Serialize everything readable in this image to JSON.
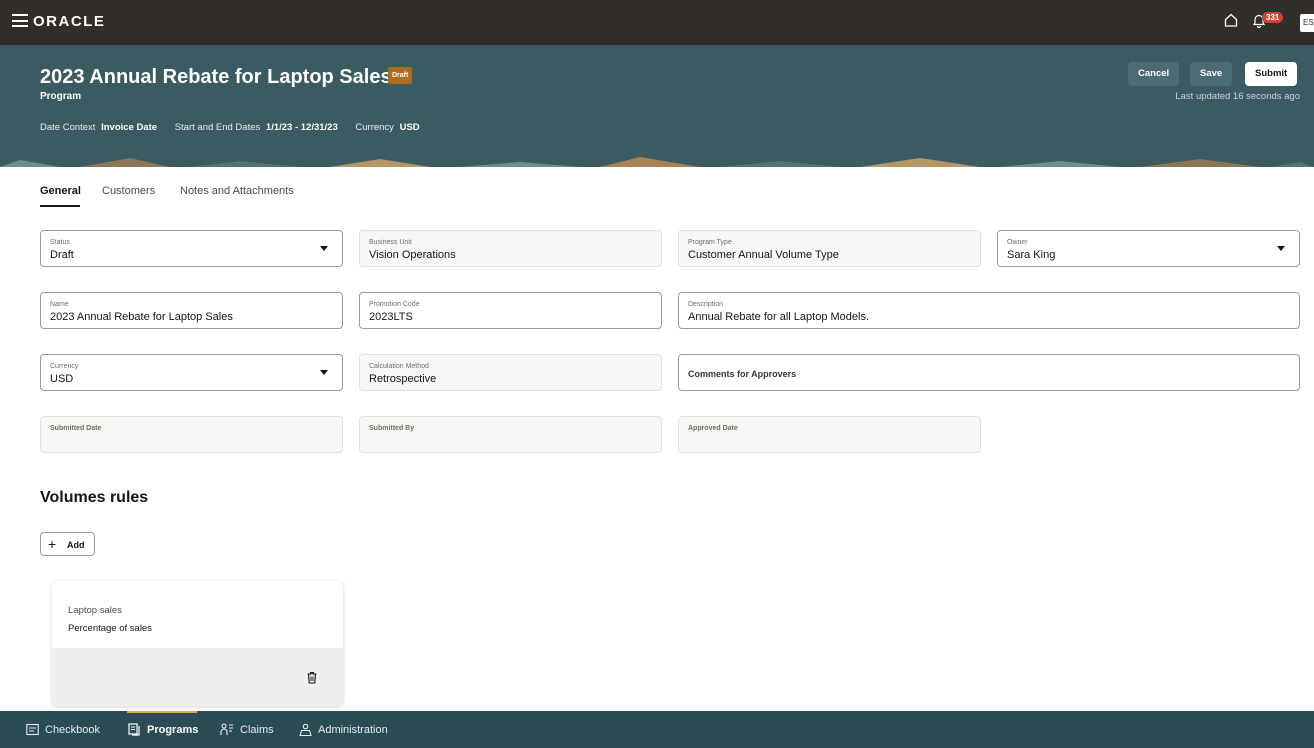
{
  "topbar": {
    "brand": "ORACLE",
    "notification_count": "331",
    "user_initials": "ES"
  },
  "header": {
    "title": "2023 Annual Rebate for Laptop Sales",
    "status_badge": "Draft",
    "subtitle": "Program",
    "date_context_label": "Date Context",
    "date_context_value": "Invoice Date",
    "dates_label": "Start and End Dates",
    "dates_value": "1/1/23 - 12/31/23",
    "currency_label": "Currency",
    "currency_value": "USD",
    "cancel_label": "Cancel",
    "save_label": "Save",
    "submit_label": "Submit",
    "last_updated": "Last updated 16 seconds ago",
    "colors": {
      "header_bg": "#3b5a62",
      "topbar_bg": "#312d2a",
      "badge": "#ac6d1c"
    }
  },
  "tabs": [
    {
      "label": "General",
      "active": true
    },
    {
      "label": "Customers",
      "active": false
    },
    {
      "label": "Notes and Attachments",
      "active": false
    }
  ],
  "fields": {
    "status": {
      "label": "Status",
      "value": "Draft"
    },
    "business_unit": {
      "label": "Business Unit",
      "value": "Vision Operations"
    },
    "program_type": {
      "label": "Program Type",
      "value": "Customer Annual Volume Type"
    },
    "owner": {
      "label": "Owner",
      "value": "Sara King"
    },
    "name": {
      "label": "Name",
      "value": "2023 Annual Rebate for Laptop Sales"
    },
    "promotion_code": {
      "label": "Promotion Code",
      "value": "2023LTS"
    },
    "description": {
      "label": "Description",
      "value": "Annual Rebate for all Laptop Models."
    },
    "currency": {
      "label": "Currency",
      "value": "USD"
    },
    "calculation_method": {
      "label": "Calculation Method",
      "value": "Retrospective"
    },
    "comments": {
      "label": "Comments for Approvers"
    },
    "submitted_date": {
      "label": "Submitted Date"
    },
    "submitted_by": {
      "label": "Submitted By"
    },
    "approved_date": {
      "label": "Approved Date"
    }
  },
  "volume_rules": {
    "title": "Volumes rules",
    "add_label": "Add",
    "cards": [
      {
        "title": "Laptop sales",
        "subtitle": "Percentage of sales"
      }
    ]
  },
  "bottom_nav": [
    {
      "label": "Checkbook",
      "icon": "checkbook-icon",
      "active": false
    },
    {
      "label": "Programs",
      "icon": "programs-icon",
      "active": true
    },
    {
      "label": "Claims",
      "icon": "claims-icon",
      "active": false
    },
    {
      "label": "Administration",
      "icon": "administration-icon",
      "active": false
    }
  ]
}
